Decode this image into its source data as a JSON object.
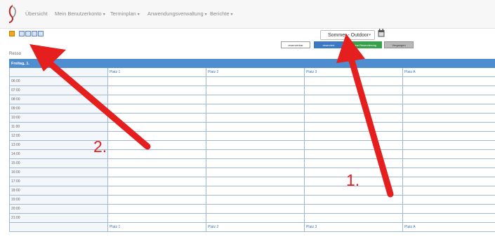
{
  "nav": {
    "items": [
      {
        "label": "Übersicht",
        "dropdown": false
      },
      {
        "label": "Mein Benutzerkonto",
        "dropdown": true
      },
      {
        "label": "Terminplan",
        "dropdown": true
      },
      {
        "label": "Anwendungsverwaltung",
        "dropdown": true
      },
      {
        "label": "Berichte",
        "dropdown": true
      }
    ]
  },
  "toolbar": {
    "icons": [
      "add-icon",
      "day-view-icon",
      "week-view-icon",
      "print-icon",
      "monitor-icon"
    ]
  },
  "category_select": {
    "value": "Sommer - Outdoor"
  },
  "legend": [
    {
      "label": "reservierbar",
      "bg": "#ffffff",
      "fg": "#333333",
      "border": "#9a9a9a"
    },
    {
      "label": "reserviert",
      "bg": "#3c79c4",
      "fg": "#ffffff",
      "border": "#3c79c4"
    },
    {
      "label": "Meine Reservierung",
      "bg": "#35a14b",
      "fg": "#ffffff",
      "border": "#35a14b"
    },
    {
      "label": "Vergangen",
      "bg": "#b8b8b8",
      "fg": "#333333",
      "border": "#8f8f8f"
    }
  ],
  "date_link_start": "Resso",
  "date_link_end": "0",
  "schedule": {
    "day_header": "Freitag, 1.",
    "columns": [
      "Platz 1",
      "Platz 2",
      "Platz 3",
      "Platz A"
    ],
    "times": [
      "06:00",
      "07:00",
      "08:00",
      "09:00",
      "10:00",
      "11:00",
      "12:00",
      "13:00",
      "14:00",
      "15:00",
      "16:00",
      "17:00",
      "18:00",
      "19:00",
      "20:00",
      "21:00"
    ]
  },
  "annotations": [
    {
      "label": "1."
    },
    {
      "label": "2."
    }
  ],
  "colors": {
    "accent": "#4e8ed0",
    "arrow": "#e51e1e",
    "grid": "#9fb9d3"
  }
}
